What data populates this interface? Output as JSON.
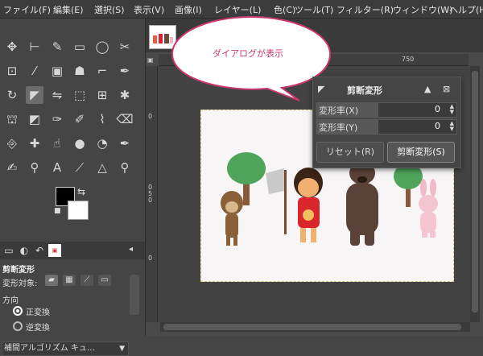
{
  "menubar": {
    "items": [
      "ファイル(F)",
      "編集(E)",
      "選択(S)",
      "表示(V)",
      "画像(I)",
      "レイヤー(L)",
      "色(C)",
      "ツール(T)",
      "フィルター(R)",
      "ウィンドウ(W)",
      "ヘルプ(H)"
    ]
  },
  "toolbox": {
    "tools": [
      "move-icon",
      "align-icon",
      "free-select-icon",
      "rect-select-icon",
      "ellipse-select-icon",
      "scissors-icon",
      "fuzzy-select-icon",
      "magic-wand-icon",
      "color-select-icon",
      "foreground-select-icon",
      "crop-icon",
      "paths-icon",
      "rotate-icon",
      "shear-icon",
      "flip-icon",
      "perspective-icon",
      "cage-transform-icon",
      "warp-icon",
      "bucket-fill-icon",
      "gradient-icon",
      "paintbrush-icon",
      "pencil-icon",
      "airbrush-icon",
      "eraser-icon",
      "clone-icon",
      "heal-icon",
      "smudge-icon",
      "blur-icon",
      "dodge-icon",
      "ink-icon",
      "mypaint-brush-icon",
      "smudge-finger-icon",
      "text-icon",
      "color-picker-icon",
      "measure-icon",
      "zoom-icon"
    ],
    "active_tool": "shear-icon",
    "fg_color": "#000000",
    "bg_color": "#ffffff"
  },
  "tool_options": {
    "title": "剪断変形",
    "transform_label": "変形対象:",
    "direction_label": "方向",
    "direction_options": [
      "正変換",
      "逆変換"
    ],
    "direction_selected": "正変換",
    "interpolation_label": "補間アルゴリズム キュ…"
  },
  "canvas": {
    "ruler_top_label": "750",
    "ruler_left_labels": [
      "0",
      "0",
      "5",
      "0",
      "0"
    ],
    "ruler_corner": "0"
  },
  "dialog": {
    "title": "剪断変形",
    "fields": [
      {
        "label": "変形率(X)",
        "value": "0"
      },
      {
        "label": "変形率(Y)",
        "value": "0"
      }
    ],
    "reset_label": "リセット(R)",
    "apply_label": "剪断変形(S)"
  },
  "annotation": {
    "bubble_text": "ダイアログが表示"
  }
}
